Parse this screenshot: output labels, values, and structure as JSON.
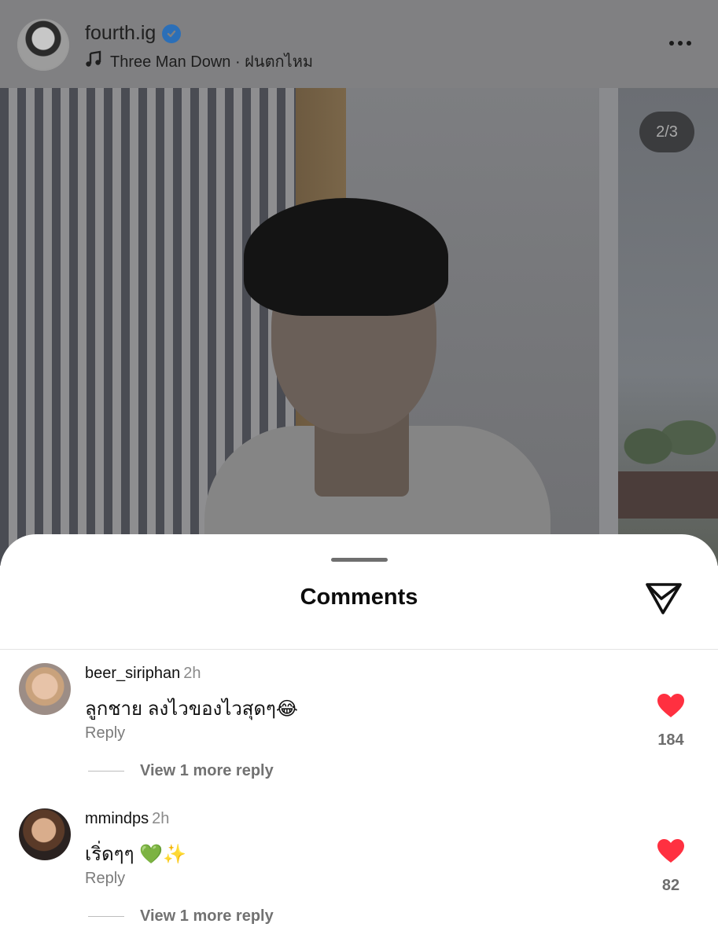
{
  "post": {
    "username": "fourth.ig",
    "verified_icon": "verified-badge-icon",
    "music_icon": "music-note-icon",
    "music_text": "Three Man Down · ฝนตกไหม",
    "more_icon": "more-horizontal-icon",
    "photo_counter": "2/3"
  },
  "sheet": {
    "title": "Comments",
    "share_icon": "send-icon"
  },
  "comments": [
    {
      "username": "beer_siriphan",
      "time": "2h",
      "text": "ลูกชาย ลงไวของไวสุดๆ😂",
      "reply_label": "Reply",
      "view_replies_label": "View 1 more reply",
      "like_count": "184"
    },
    {
      "username": "mmindps",
      "time": "2h",
      "text": "เริ่ดๆๆ 💚✨",
      "reply_label": "Reply",
      "view_replies_label": "View 1 more reply",
      "like_count": "82"
    }
  ],
  "colors": {
    "like_red": "#ff3040",
    "verified_blue": "#2b6fb8"
  }
}
